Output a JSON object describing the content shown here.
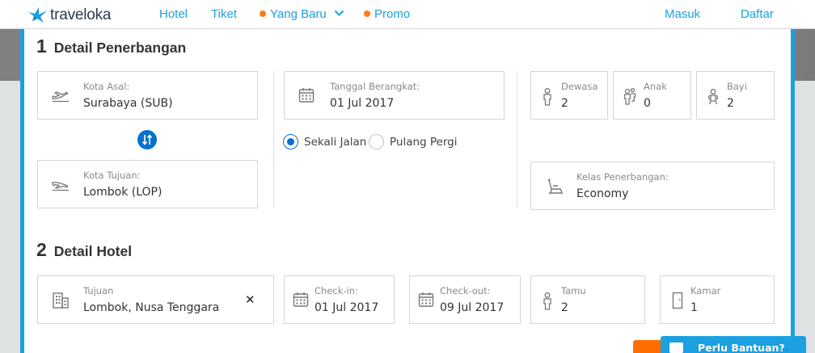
{
  "nav": {
    "logo_text": "traveloka",
    "links": [
      "Hotel",
      "Tiket",
      "Yang Baru",
      "Promo"
    ],
    "login": "Masuk",
    "register": "Daftar"
  },
  "flight": {
    "num": "1",
    "title": "Detail Penerbangan",
    "origin": {
      "label": "Kota Asal:",
      "value": "Surabaya (SUB)"
    },
    "destination": {
      "label": "Kota Tujuan:",
      "value": "Lombok (LOP)"
    },
    "depart": {
      "label": "Tanggal Berangkat:",
      "value": "01 Jul 2017"
    },
    "trip_one_way": "Sekali Jalan",
    "trip_round": "Pulang Pergi",
    "adults": {
      "label": "Dewasa",
      "value": "2"
    },
    "children": {
      "label": "Anak",
      "value": "0"
    },
    "infants": {
      "label": "Bayi",
      "value": "2"
    },
    "cabin": {
      "label": "Kelas Penerbangan:",
      "value": "Economy"
    }
  },
  "hotel": {
    "num": "2",
    "title": "Detail Hotel",
    "destination": {
      "label": "Tujuan",
      "value": "Lombok, Nusa Tenggara"
    },
    "checkin": {
      "label": "Check-in:",
      "value": "01 Jul 2017"
    },
    "checkout": {
      "label": "Check-out:",
      "value": "09 Jul 2017"
    },
    "guests": {
      "label": "Tamu",
      "value": "2"
    },
    "rooms": {
      "label": "Kamar",
      "value": "1"
    }
  },
  "help": {
    "label": "Perlu Bantuan?"
  },
  "colors": {
    "brand_blue": "#1ba0e2",
    "accent_blue": "#0770cd",
    "orange": "#ff7b13"
  }
}
